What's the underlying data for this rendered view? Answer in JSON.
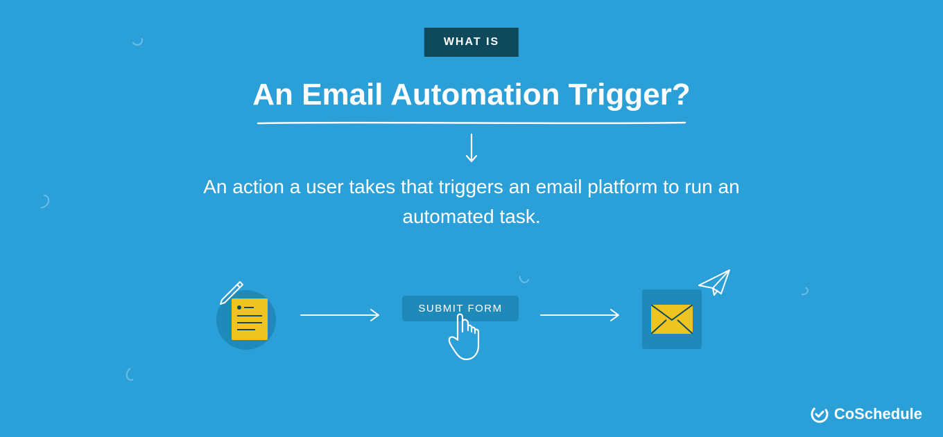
{
  "eyebrow": "WHAT IS",
  "headline": "An Email Automation Trigger?",
  "definition": "An action a user takes that triggers an email platform to run an automated task.",
  "submit_label": "SUBMIT FORM",
  "brand": "CoSchedule",
  "icons": {
    "form": "note-pencil-icon",
    "submit": "pointer-click-icon",
    "email": "envelope-icon",
    "plane": "paper-plane-icon"
  }
}
